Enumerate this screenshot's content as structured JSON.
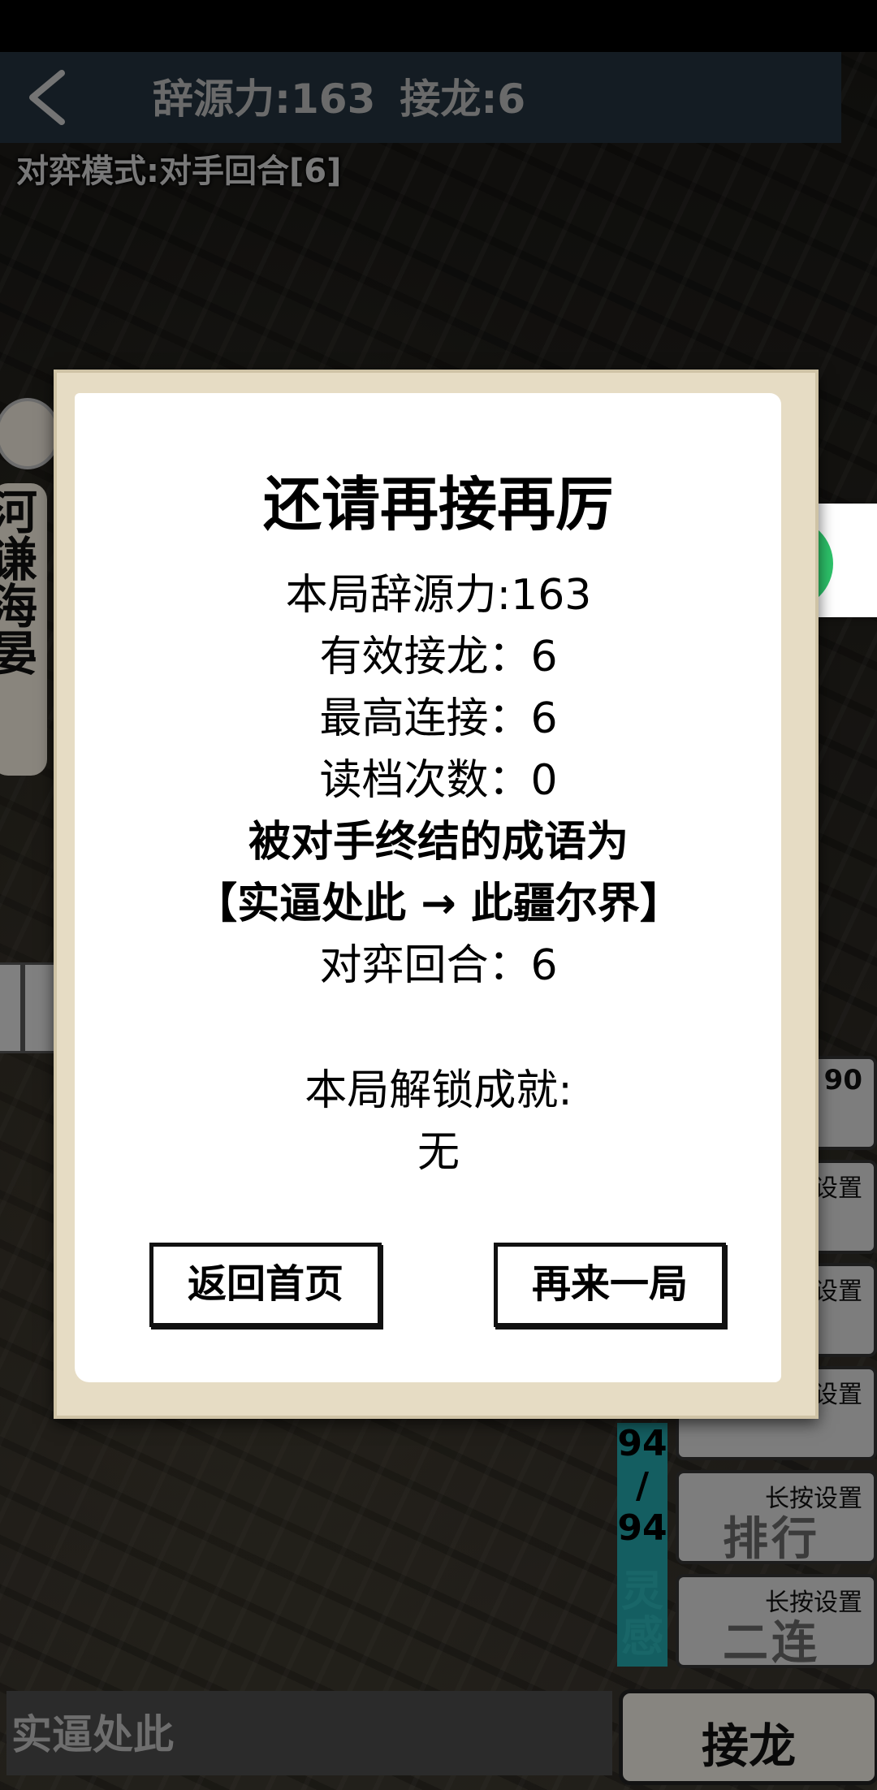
{
  "header": {
    "ciyuanli": "辞源力:163",
    "jielong": "接龙:6",
    "mode": "对弈模式:对手回合[6]"
  },
  "opponent": {
    "name": "河谦海晏"
  },
  "side_counter": {
    "top": "94",
    "sep": "/",
    "bottom": "94",
    "label": "灵感"
  },
  "skills": [
    {
      "label": "",
      "number": "90",
      "glyph": ""
    },
    {
      "label": "长按设置",
      "glyph": ""
    },
    {
      "label": "长按设置",
      "glyph": ""
    },
    {
      "label": "长按设置",
      "glyph": ""
    },
    {
      "label": "长按设置",
      "glyph": "排行"
    },
    {
      "label": "长按设置",
      "glyph": "二连"
    }
  ],
  "input": {
    "value": "实逼处此"
  },
  "submit": {
    "label": "接龙"
  },
  "dialog": {
    "title": "还请再接再厉",
    "score": "本局辞源力:163",
    "valid": "有效接龙：6",
    "max_combo": "最高连接：6",
    "loads": "读档次数：0",
    "ended_label": "被对手终结的成语为",
    "ended_pair": "【实逼处此 → 此疆尔界】",
    "rounds": "对弈回合：6",
    "achievements_label": "本局解锁成就:",
    "achievements_value": "无",
    "btn_home": "返回首页",
    "btn_again": "再来一局"
  },
  "colors": {
    "top_bar": "#23313d",
    "accent_teal": "#24a3a7",
    "wechat_green": "#2dc36a"
  },
  "icons": [
    "back-arrow-icon",
    "wechat-share-icon"
  ]
}
